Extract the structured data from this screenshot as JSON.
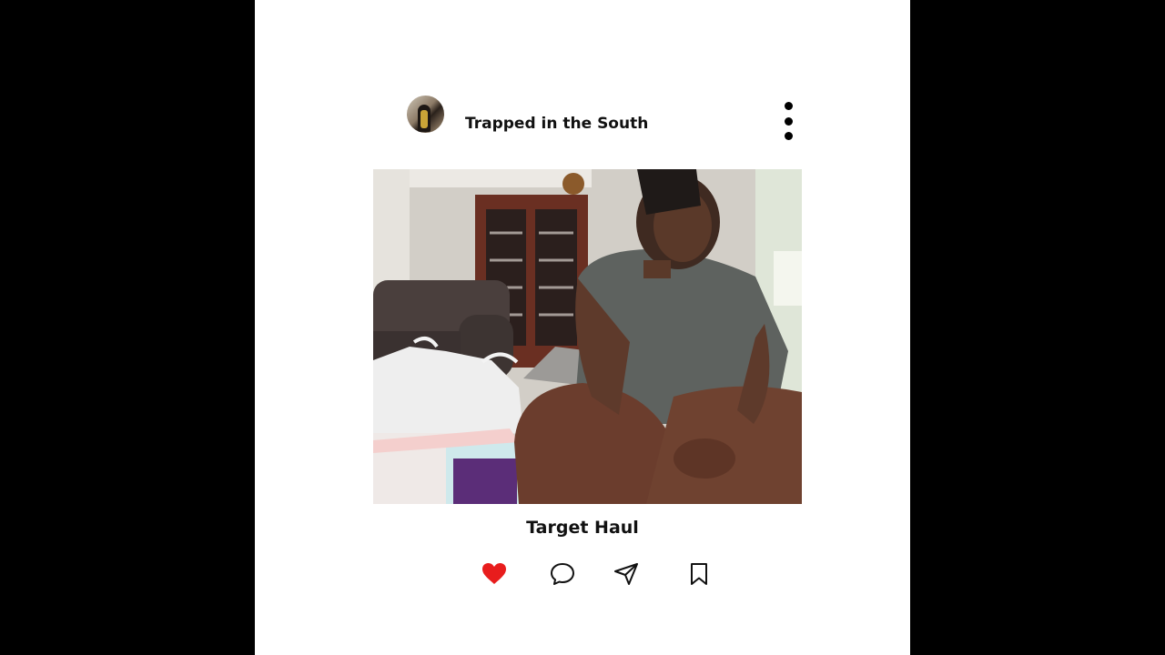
{
  "post": {
    "username": "Trapped in the South",
    "caption": "Target Haul",
    "liked": true
  },
  "icons": {
    "avatar": "profile-avatar",
    "more": "more-vertical-icon",
    "like": "heart-icon",
    "comment": "comment-icon",
    "share": "send-icon",
    "save": "bookmark-icon"
  },
  "colors": {
    "background": "#000000",
    "card": "#ffffff",
    "like": "#e81d1d",
    "text": "#111111"
  }
}
